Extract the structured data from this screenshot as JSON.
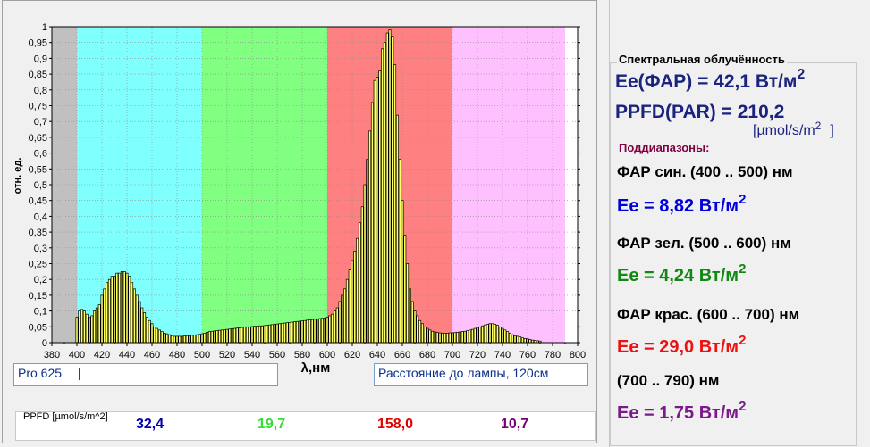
{
  "chart_data": {
    "type": "bar",
    "xlabel": "λ,нм",
    "ylabel": "отн. ед.",
    "xlim": [
      380,
      800
    ],
    "ylim": [
      0,
      1
    ],
    "x_ticks": [
      "380",
      "400",
      "420",
      "440",
      "460",
      "480",
      "500",
      "520",
      "540",
      "560",
      "580",
      "600",
      "620",
      "640",
      "660",
      "680",
      "700",
      "720",
      "740",
      "760",
      "780",
      "800"
    ],
    "y_ticks": [
      "0",
      "0,05",
      "0,1",
      "0,15",
      "0,2",
      "0,25",
      "0,3",
      "0,35",
      "0,4",
      "0,45",
      "0,5",
      "0,55",
      "0,6",
      "0,65",
      "0,7",
      "0,75",
      "0,8",
      "0,85",
      "0,9",
      "0,95",
      "1"
    ],
    "bands": [
      {
        "from": 380,
        "to": 400,
        "color": "#c0c0c0"
      },
      {
        "from": 400,
        "to": 500,
        "color": "#80ffff"
      },
      {
        "from": 500,
        "to": 600,
        "color": "#80ff80"
      },
      {
        "from": 600,
        "to": 700,
        "color": "#ff8080"
      },
      {
        "from": 700,
        "to": 790,
        "color": "#ffc0ff"
      }
    ],
    "bar_color": "#ffff66",
    "x": [
      400,
      402,
      404,
      406,
      408,
      410,
      412,
      414,
      416,
      418,
      420,
      422,
      424,
      426,
      428,
      430,
      432,
      434,
      436,
      438,
      440,
      442,
      444,
      446,
      448,
      450,
      452,
      454,
      456,
      458,
      460,
      462,
      464,
      466,
      468,
      470,
      472,
      474,
      476,
      478,
      480,
      482,
      484,
      486,
      488,
      490,
      492,
      494,
      496,
      498,
      500,
      502,
      504,
      506,
      508,
      510,
      512,
      514,
      516,
      518,
      520,
      522,
      524,
      526,
      528,
      530,
      532,
      534,
      536,
      538,
      540,
      542,
      544,
      546,
      548,
      550,
      552,
      554,
      556,
      558,
      560,
      562,
      564,
      566,
      568,
      570,
      572,
      574,
      576,
      578,
      580,
      582,
      584,
      586,
      588,
      590,
      592,
      594,
      596,
      598,
      600,
      602,
      604,
      606,
      608,
      610,
      612,
      614,
      616,
      618,
      620,
      622,
      624,
      626,
      628,
      630,
      632,
      634,
      636,
      638,
      640,
      642,
      644,
      646,
      648,
      650,
      652,
      654,
      656,
      658,
      660,
      662,
      664,
      666,
      668,
      670,
      672,
      674,
      676,
      678,
      680,
      682,
      684,
      686,
      688,
      690,
      692,
      694,
      696,
      698,
      700,
      702,
      704,
      706,
      708,
      710,
      712,
      714,
      716,
      718,
      720,
      722,
      724,
      726,
      728,
      730,
      732,
      734,
      736,
      738,
      740,
      742,
      744,
      746,
      748,
      750,
      752,
      754,
      756,
      758,
      760,
      762,
      764,
      766,
      768,
      770,
      772,
      774,
      776,
      778,
      780,
      782,
      784,
      786,
      788,
      790
    ],
    "values": [
      0.08,
      0.1,
      0.105,
      0.1,
      0.09,
      0.08,
      0.085,
      0.1,
      0.11,
      0.12,
      0.15,
      0.17,
      0.19,
      0.2,
      0.21,
      0.21,
      0.22,
      0.22,
      0.225,
      0.225,
      0.22,
      0.21,
      0.19,
      0.17,
      0.15,
      0.13,
      0.11,
      0.095,
      0.08,
      0.07,
      0.06,
      0.05,
      0.045,
      0.04,
      0.035,
      0.03,
      0.028,
      0.025,
      0.022,
      0.02,
      0.02,
      0.02,
      0.02,
      0.021,
      0.022,
      0.022,
      0.023,
      0.024,
      0.025,
      0.026,
      0.028,
      0.03,
      0.033,
      0.035,
      0.036,
      0.037,
      0.038,
      0.039,
      0.04,
      0.041,
      0.042,
      0.043,
      0.044,
      0.045,
      0.046,
      0.047,
      0.048,
      0.049,
      0.05,
      0.05,
      0.051,
      0.052,
      0.052,
      0.053,
      0.053,
      0.054,
      0.055,
      0.056,
      0.057,
      0.058,
      0.059,
      0.06,
      0.061,
      0.062,
      0.063,
      0.064,
      0.065,
      0.066,
      0.067,
      0.068,
      0.069,
      0.07,
      0.071,
      0.072,
      0.073,
      0.074,
      0.075,
      0.076,
      0.077,
      0.078,
      0.08,
      0.085,
      0.09,
      0.1,
      0.11,
      0.13,
      0.15,
      0.17,
      0.2,
      0.23,
      0.26,
      0.29,
      0.33,
      0.38,
      0.43,
      0.5,
      0.58,
      0.67,
      0.76,
      0.83,
      0.84,
      0.86,
      0.93,
      0.95,
      0.98,
      0.99,
      0.97,
      0.88,
      0.72,
      0.58,
      0.45,
      0.34,
      0.25,
      0.17,
      0.13,
      0.1,
      0.085,
      0.07,
      0.06,
      0.05,
      0.045,
      0.04,
      0.036,
      0.034,
      0.032,
      0.031,
      0.03,
      0.03,
      0.03,
      0.031,
      0.031,
      0.032,
      0.033,
      0.034,
      0.035,
      0.036,
      0.038,
      0.04,
      0.042,
      0.045,
      0.048,
      0.05,
      0.053,
      0.056,
      0.058,
      0.06,
      0.06,
      0.058,
      0.055,
      0.05,
      0.045,
      0.04,
      0.035,
      0.03,
      0.025,
      0.022,
      0.02,
      0.018,
      0.015,
      0.013,
      0.012,
      0.01,
      0.008,
      0.007,
      0.006,
      0.005
    ]
  },
  "lamp_field": {
    "value": "Pro 625"
  },
  "distance_field": {
    "value": "Расстояние до лампы,  120см"
  },
  "ppfd": {
    "label": "PPFD [µmol/s/m^2]",
    "values": [
      {
        "text": "32,4",
        "color": "#0000aa"
      },
      {
        "text": "19,7",
        "color": "#33dd33"
      },
      {
        "text": "158,0",
        "color": "#dd0000"
      },
      {
        "text": "10,7",
        "color": "#770077"
      }
    ]
  },
  "info": {
    "title": "Спектральная облучённость",
    "ee_total": "Ee(ФАР) = 42,1 Вт/м",
    "ee_total_sup": "2",
    "ppfd_total": "PPFD(PAR) = 210,2",
    "ppfd_unit": "[µmol/s/m",
    "ppfd_unit_sup": "2",
    "ppfd_unit_close": "]",
    "subranges": "Поддиапазоны:",
    "blue_range": "ФАР син. (400 .. 500) нм",
    "blue_ee": "Ee = 8,82 Вт/м",
    "green_range": "ФАР зел. (500 .. 600) нм",
    "green_ee": "Ee = 4,24 Вт/м",
    "red_range": "ФАР крас. (600 .. 700) нм",
    "red_ee": "Ee = 29,0 Вт/м",
    "far_range": "(700 .. 790) нм",
    "far_ee": "Ee = 1,75 Вт/м",
    "sup": "2",
    "colors": {
      "navy": "#1a237e",
      "blue": "#0000dd",
      "green": "#118811",
      "red": "#ee1111",
      "purple": "#7b1a8b",
      "subrange": "#800040"
    }
  }
}
